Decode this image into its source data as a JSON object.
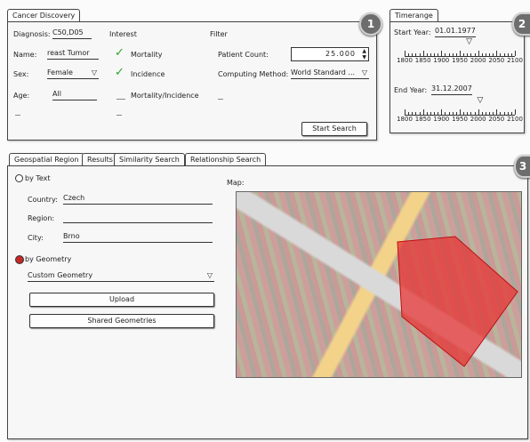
{
  "search_panel": {
    "tab_label": "Cancer Discovery",
    "diagnosis_label": "Diagnosis:",
    "diagnosis_value": "C50,D05",
    "interest_label": "Interest",
    "filter_label": "Filter",
    "name_label": "Name:",
    "name_value": "reast Tumor",
    "mortality_label": "Mortality",
    "patient_count_label": "Patient Count:",
    "patient_count_value": "25.000",
    "sex_label": "Sex:",
    "sex_value": "Female",
    "incidence_label": "Incidence",
    "computing_method_label": "Computing Method:",
    "computing_method_value": "World Standard ...",
    "age_label": "Age:",
    "age_value": "All",
    "mortality_incidence_label": "Mortality/Incidence",
    "start_search_label": "Start Search",
    "badge": "1"
  },
  "timerange_panel": {
    "tab_label": "Timerange",
    "start_year_label": "Start Year:",
    "start_year_value": "01.01.1977",
    "end_year_label": "End Year:",
    "end_year_value": "31.12.2007",
    "scale_labels": [
      "1800",
      "1850",
      "1900",
      "1950",
      "2000",
      "2050",
      "2100"
    ],
    "start_slider_value": 1977,
    "end_slider_value": 2007,
    "badge": "2"
  },
  "lower_panel": {
    "tabs": [
      "Geospatial Region",
      "Results",
      "Similarity Search",
      "Relationship Search"
    ],
    "by_text_label": "by Text",
    "country_label": "Country:",
    "country_value": "Czech",
    "region_label": "Region:",
    "region_value": "",
    "city_label": "City:",
    "city_value": "Brno",
    "by_geometry_label": "by Geometry",
    "geometry_select_value": "Custom Geometry",
    "upload_label": "Upload",
    "shared_geometries_label": "Shared Geometries",
    "map_label": "Map:",
    "badge": "3"
  },
  "icons": {
    "check": "check-icon",
    "dropdown": "chevron-down-icon",
    "radio": "radio-icon"
  },
  "colors": {
    "check": "#2aa52a",
    "polygon": "#e83030",
    "radio_selected": "#c62828"
  }
}
